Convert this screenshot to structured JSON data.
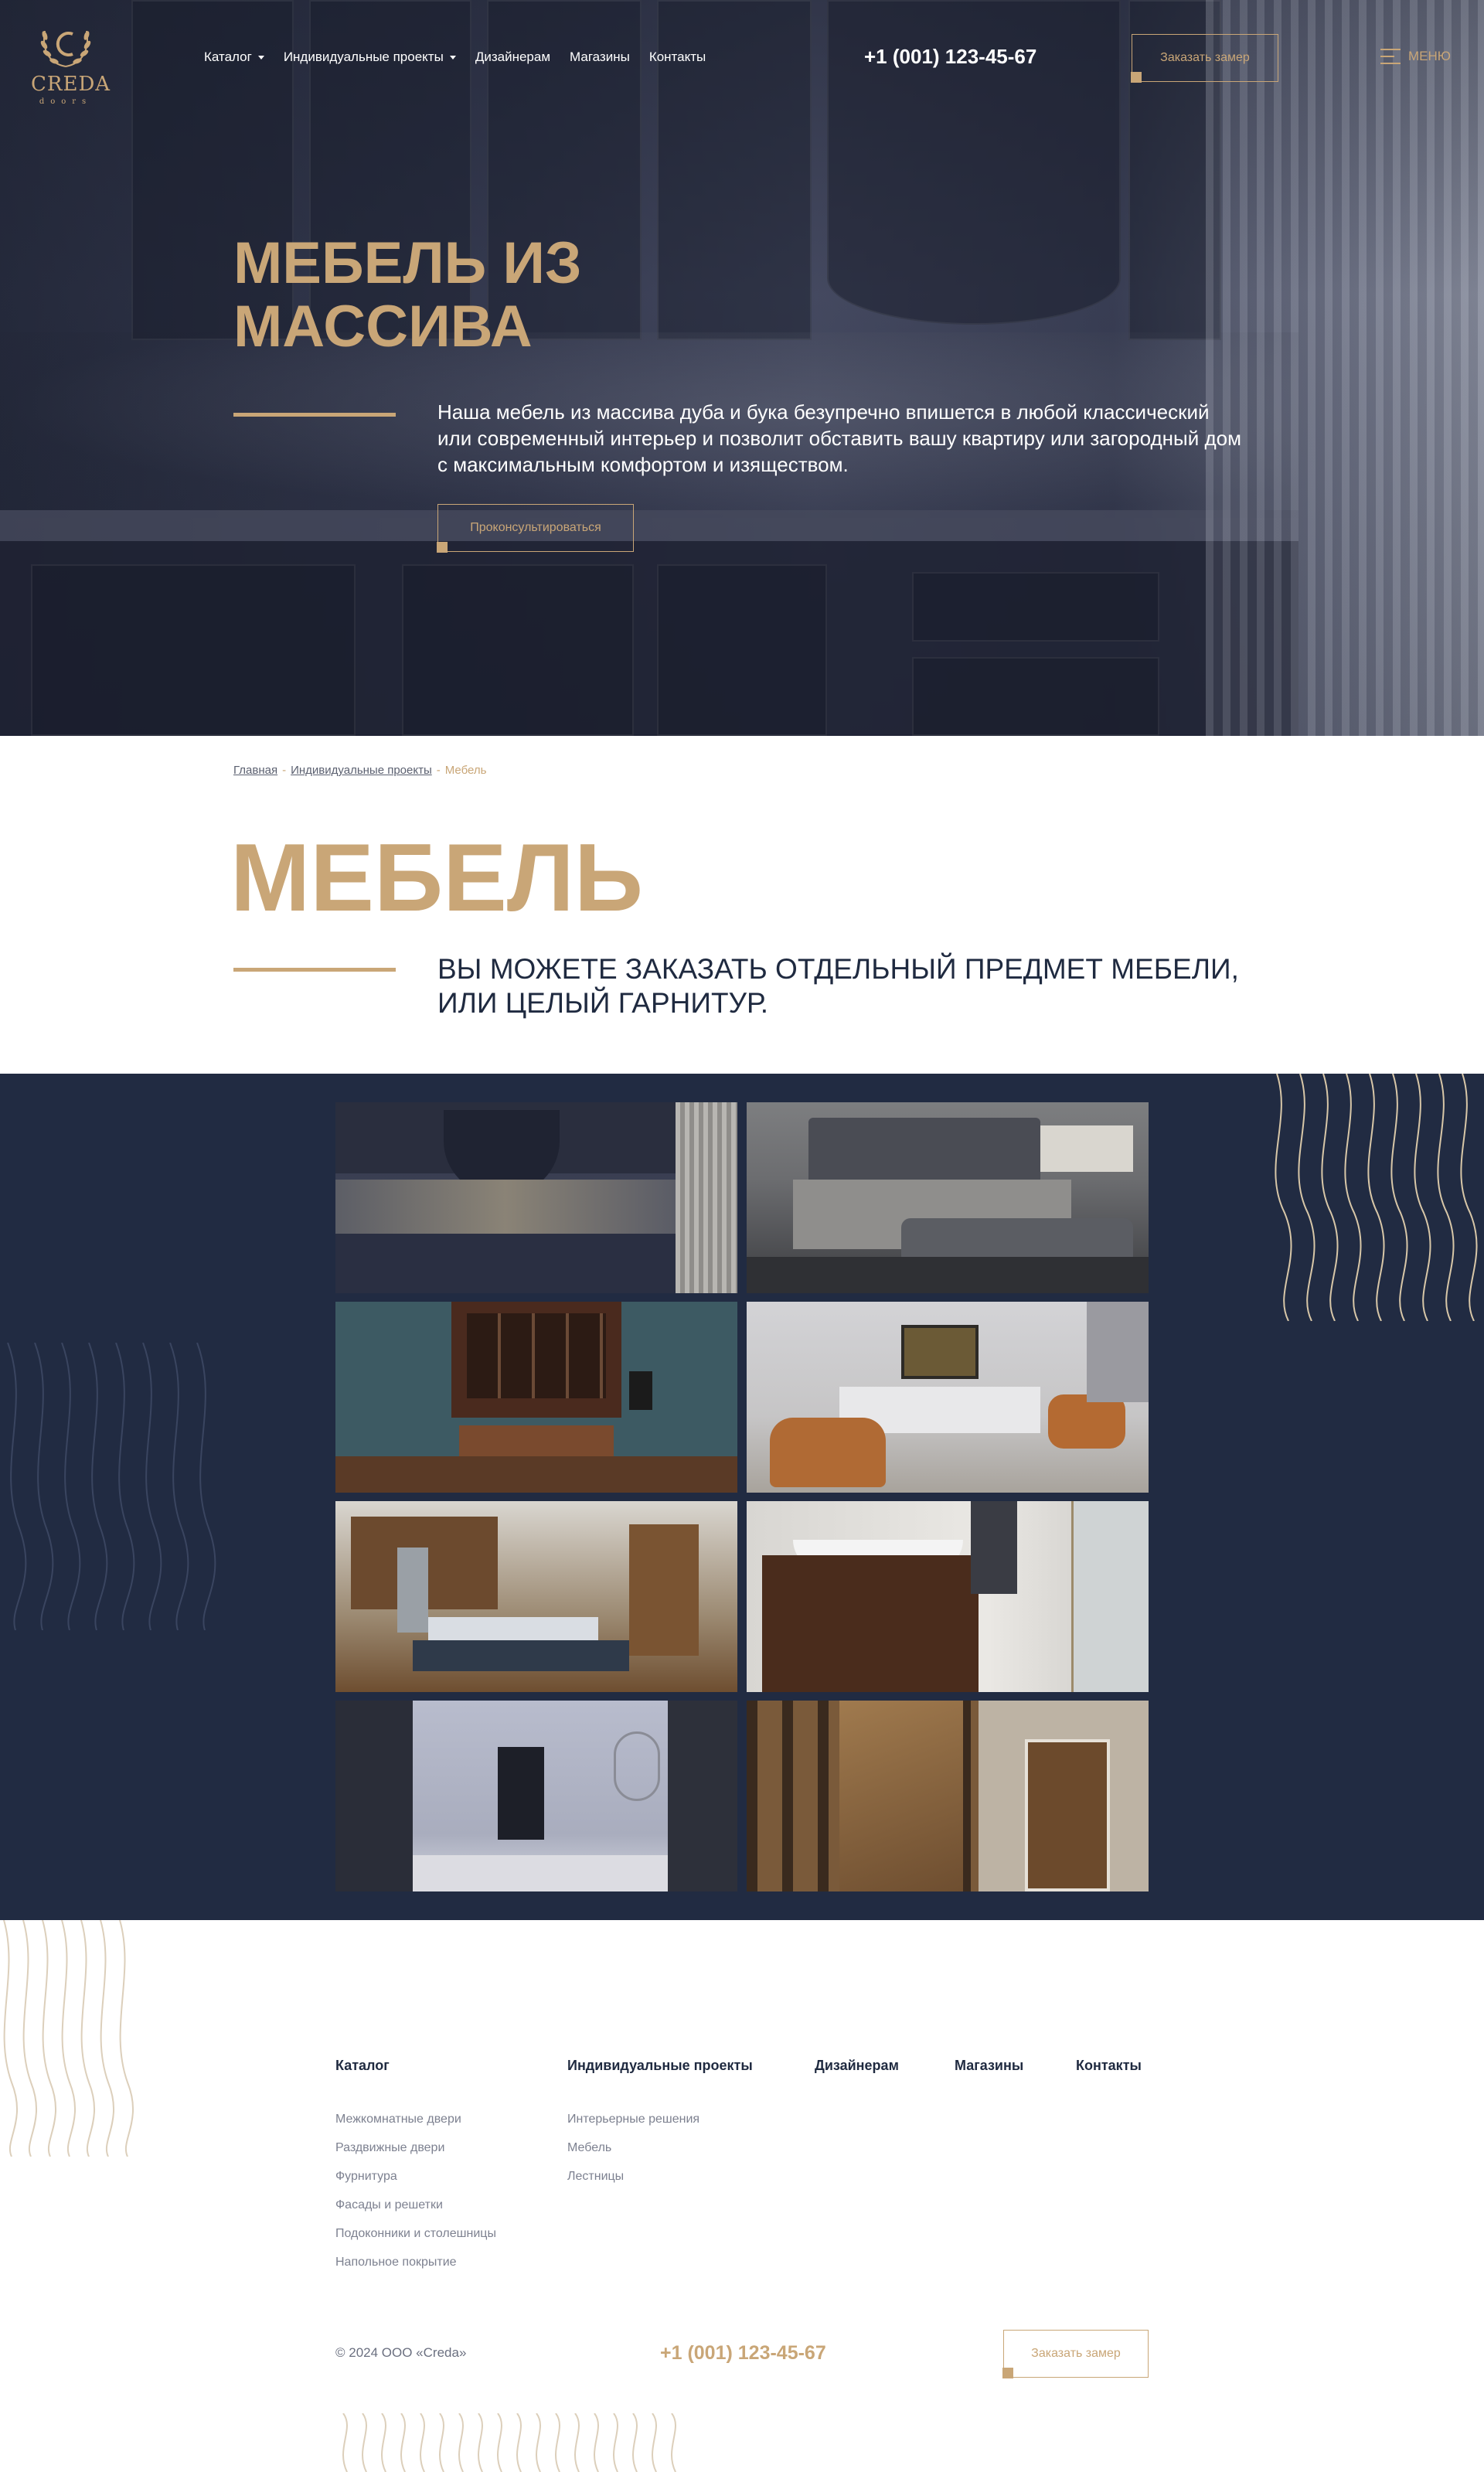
{
  "header": {
    "logo_word": "CREDA",
    "logo_sub": "doors",
    "nav": [
      {
        "label": "Каталог",
        "has_dropdown": true
      },
      {
        "label": "Индивидуальные проекты",
        "has_dropdown": true
      },
      {
        "label": "Дизайнерам",
        "has_dropdown": false
      },
      {
        "label": "Магазины",
        "has_dropdown": false
      },
      {
        "label": "Контакты",
        "has_dropdown": false
      }
    ],
    "phone": "+1 (001) 123-45-67",
    "order_button": "Заказать замер",
    "menu_label": "МЕНЮ"
  },
  "hero": {
    "title": "МЕБЕЛЬ ИЗ МАССИВА",
    "text": "Наша мебель из массива дуба и бука безупречно впишется в любой классический или современный интерьер и позволит обставить вашу квартиру или загородный дом с максимальным комфортом и изяществом.",
    "button": "Проконсультироваться"
  },
  "breadcrumb": {
    "items": [
      "Главная",
      "Индивидуальные проекты"
    ],
    "current": "Мебель"
  },
  "intro": {
    "title": "МЕБЕЛЬ",
    "text": "ВЫ МОЖЕТЕ ЗАКАЗАТЬ ОТДЕЛЬНЫЙ ПРЕДМЕТ МЕБЕЛИ, ИЛИ ЦЕЛЫЙ ГАРНИТУР."
  },
  "gallery": {
    "images": [
      {
        "name": "kitchen-dark-photo"
      },
      {
        "name": "bedroom-photo"
      },
      {
        "name": "cabinet-office-photo"
      },
      {
        "name": "living-room-photo"
      },
      {
        "name": "kitchen-dining-photo"
      },
      {
        "name": "bathroom-vanity-photo"
      },
      {
        "name": "hallway-photo"
      },
      {
        "name": "wood-panels-door-photo"
      }
    ]
  },
  "footer": {
    "columns": [
      {
        "title": "Каталог",
        "links": [
          "Межкомнатные двери",
          "Раздвижные двери",
          "Фурнитура",
          "Фасады и решетки",
          "Подоконники и столешницы",
          "Напольное покрытие"
        ]
      },
      {
        "title": "Индивидуальные проекты",
        "links": [
          "Интерьерные решения",
          "Мебель",
          "Лестницы"
        ]
      },
      {
        "title": "Дизайнерам",
        "links": []
      },
      {
        "title": "Магазины",
        "links": []
      },
      {
        "title": "Контакты",
        "links": []
      }
    ],
    "copyright": "© 2024 ООО «Creda»",
    "phone": "+1 (001) 123-45-67",
    "order_button": "Заказать замер"
  },
  "colors": {
    "accent_gold": "#c9a677",
    "navy": "#212b42",
    "text_dark": "#1f2a40"
  }
}
